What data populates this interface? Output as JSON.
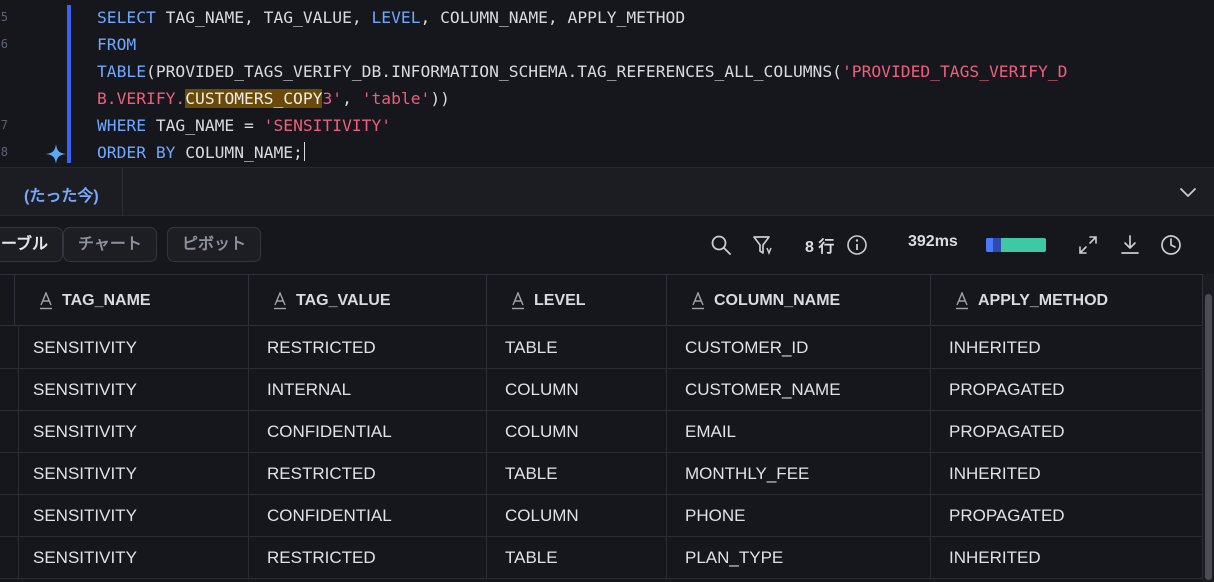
{
  "editor": {
    "line_numbers": [
      "5",
      "6",
      "",
      "",
      "7",
      "8"
    ],
    "lines": [
      {
        "segments": [
          {
            "t": "SELECT",
            "c": "kw"
          },
          {
            "t": " TAG_NAME, TAG_VALUE, ",
            "c": ""
          },
          {
            "t": "LEVEL",
            "c": "kw"
          },
          {
            "t": ", COLUMN_NAME, APPLY_METHOD",
            "c": ""
          }
        ]
      },
      {
        "segments": [
          {
            "t": "FROM",
            "c": "kw"
          }
        ]
      },
      {
        "segments": [
          {
            "t": "TABLE",
            "c": "kw"
          },
          {
            "t": "(PROVIDED_TAGS_VERIFY_DB.INFORMATION_SCHEMA.TAG_REFERENCES_ALL_COLUMNS(",
            "c": ""
          },
          {
            "t": "'PROVIDED_TAGS_VERIFY_D",
            "c": "str"
          }
        ]
      },
      {
        "segments": [
          {
            "t": "B.VERIFY.",
            "c": "str"
          },
          {
            "t": "CUSTOMERS_COPY",
            "c": "hl"
          },
          {
            "t": "3'",
            "c": "str"
          },
          {
            "t": ", ",
            "c": ""
          },
          {
            "t": "'table'",
            "c": "str"
          },
          {
            "t": "))",
            "c": ""
          }
        ]
      },
      {
        "segments": [
          {
            "t": "WHERE",
            "c": "kw"
          },
          {
            "t": " TAG_NAME = ",
            "c": ""
          },
          {
            "t": "'SENSITIVITY'",
            "c": "str"
          }
        ]
      },
      {
        "segments": [
          {
            "t": "ORDER BY",
            "c": "kw"
          },
          {
            "t": " COLUMN_NAME;",
            "c": ""
          }
        ]
      }
    ]
  },
  "result_tab": {
    "label": "(たった今)"
  },
  "toolbar": {
    "views": [
      "ーブル",
      "チャート",
      "ピボット"
    ],
    "rows_label": "8 行",
    "duration_label": "392ms",
    "colors": {
      "accent": "#4a78ff",
      "timing_fill": "#3ec9a4"
    }
  },
  "table": {
    "columns": [
      "TAG_NAME",
      "TAG_VALUE",
      "LEVEL",
      "COLUMN_NAME",
      "APPLY_METHOD"
    ],
    "rows": [
      [
        "SENSITIVITY",
        "RESTRICTED",
        "TABLE",
        "CUSTOMER_ID",
        "INHERITED"
      ],
      [
        "SENSITIVITY",
        "INTERNAL",
        "COLUMN",
        "CUSTOMER_NAME",
        "PROPAGATED"
      ],
      [
        "SENSITIVITY",
        "CONFIDENTIAL",
        "COLUMN",
        "EMAIL",
        "PROPAGATED"
      ],
      [
        "SENSITIVITY",
        "RESTRICTED",
        "TABLE",
        "MONTHLY_FEE",
        "INHERITED"
      ],
      [
        "SENSITIVITY",
        "CONFIDENTIAL",
        "COLUMN",
        "PHONE",
        "PROPAGATED"
      ],
      [
        "SENSITIVITY",
        "RESTRICTED",
        "TABLE",
        "PLAN_TYPE",
        "INHERITED"
      ]
    ]
  }
}
